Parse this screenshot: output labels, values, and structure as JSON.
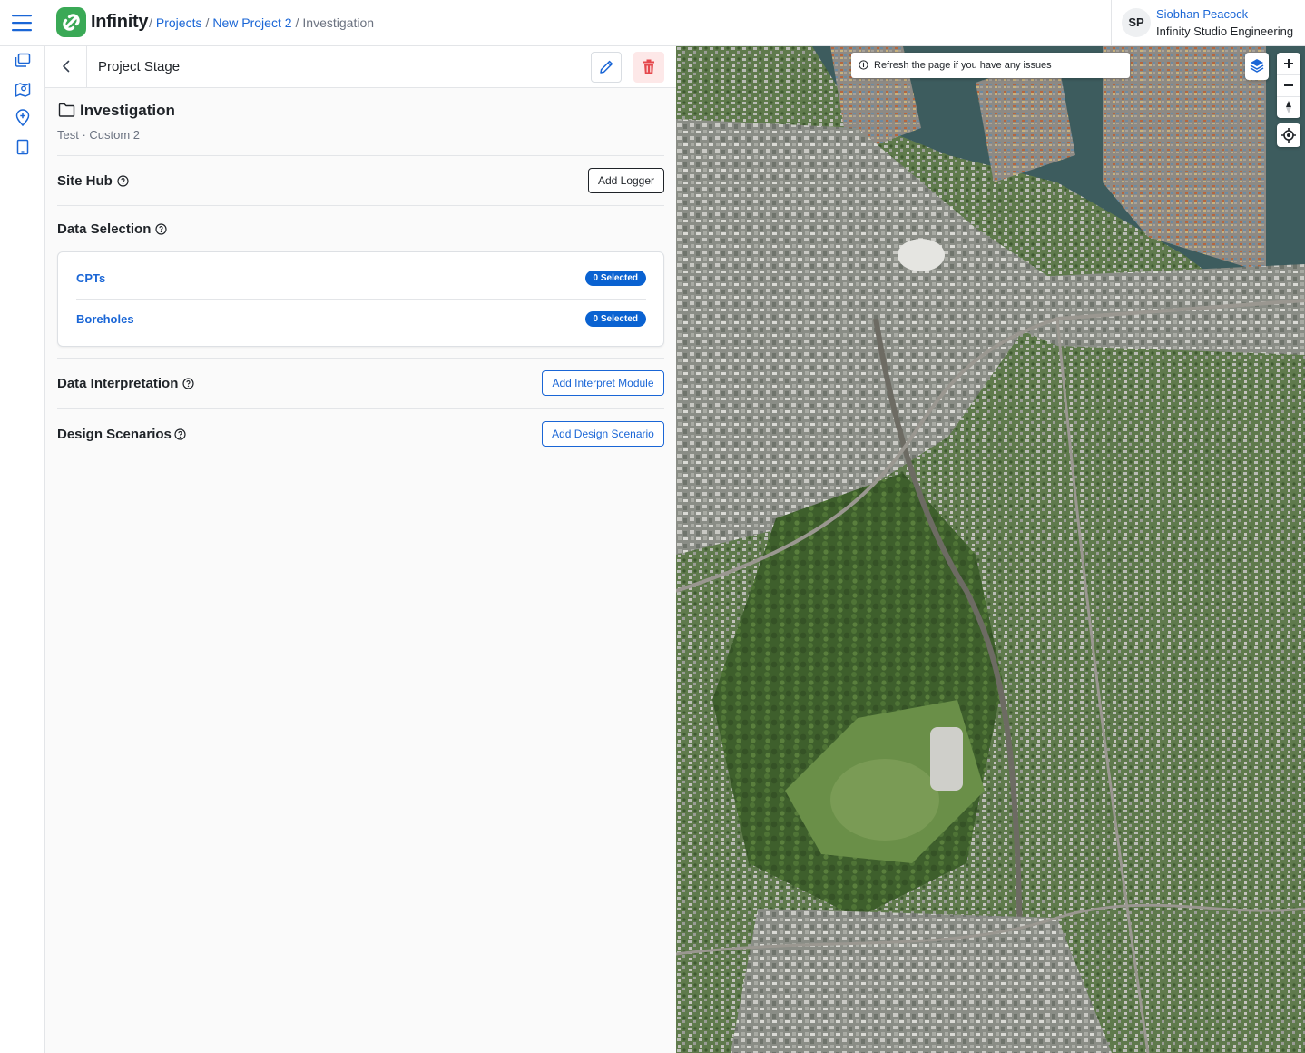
{
  "header": {
    "brand": "Infinity",
    "breadcrumbs": [
      {
        "label": "Projects"
      },
      {
        "label": "New Project 2"
      },
      {
        "label": "Investigation"
      }
    ],
    "user": {
      "initials": "SP",
      "name": "Siobhan Peacock",
      "org": "Infinity Studio Engineering"
    }
  },
  "rail": {
    "icons": [
      "projects-icon",
      "map-icon",
      "location-icon",
      "tablet-icon"
    ]
  },
  "panel": {
    "title": "Project Stage",
    "stage": {
      "name": "Investigation",
      "subtitle": "Test · Custom 2"
    },
    "site_hub": {
      "title": "Site Hub",
      "button": "Add Logger"
    },
    "data_selection": {
      "title": "Data Selection",
      "items": [
        {
          "label": "CPTs",
          "badge": "0 Selected"
        },
        {
          "label": "Boreholes",
          "badge": "0 Selected"
        }
      ]
    },
    "data_interpretation": {
      "title": "Data Interpretation",
      "button": "Add Interpret Module"
    },
    "design_scenarios": {
      "title": "Design Scenarios",
      "button": "Add Design Scenario"
    }
  },
  "map": {
    "notice": "Refresh the page if you have any issues",
    "controls": [
      "layers-icon",
      "zoom-in-icon",
      "zoom-out-icon",
      "compass-icon",
      "locate-icon"
    ]
  },
  "colors": {
    "accent": "#1a66d6",
    "badge": "#0a62d1",
    "brand_green": "#3aa956",
    "danger": "#e5484d"
  }
}
